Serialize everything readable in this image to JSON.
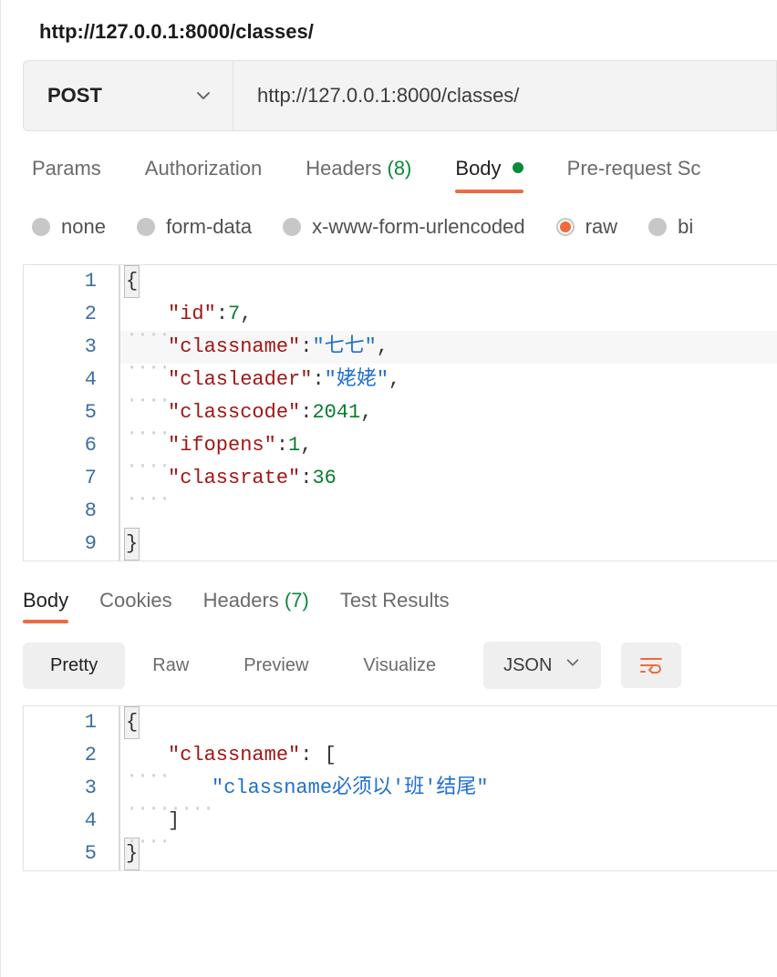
{
  "tab_title": "http://127.0.0.1:8000/classes/",
  "request": {
    "method": "POST",
    "url": "http://127.0.0.1:8000/classes/"
  },
  "request_tabs": {
    "params": "Params",
    "authorization": "Authorization",
    "headers_label": "Headers",
    "headers_count": "(8)",
    "body": "Body",
    "prerequest": "Pre-request Sc"
  },
  "body_types": {
    "none": "none",
    "form_data": "form-data",
    "xwww": "x-www-form-urlencoded",
    "raw": "raw",
    "binary": "bi"
  },
  "request_body_lines": [
    {
      "n": "1",
      "brace_open": true
    },
    {
      "n": "2",
      "indent": 4,
      "key": "\"id\"",
      "punc1": ":",
      "num": "7",
      "trail": ","
    },
    {
      "n": "3",
      "indent": 4,
      "key": "\"classname\"",
      "punc1": ":",
      "str": "\"七七\"",
      "trail": ",",
      "hl": true
    },
    {
      "n": "4",
      "indent": 4,
      "key": "\"clasleader\"",
      "punc1": ":",
      "str": "\"姥姥\"",
      "trail": ","
    },
    {
      "n": "5",
      "indent": 4,
      "key": "\"classcode\"",
      "punc1": ":",
      "num": "2041",
      "trail": ","
    },
    {
      "n": "6",
      "indent": 4,
      "key": "\"ifopens\"",
      "punc1": ":",
      "num": "1",
      "trail": ","
    },
    {
      "n": "7",
      "indent": 4,
      "key": "\"classrate\"",
      "punc1": ":",
      "num": "36"
    },
    {
      "n": "8",
      "blank": true
    },
    {
      "n": "9",
      "brace_close": true
    }
  ],
  "response_tabs": {
    "body": "Body",
    "cookies": "Cookies",
    "headers_label": "Headers",
    "headers_count": "(7)",
    "test_results": "Test Results"
  },
  "view_modes": {
    "pretty": "Pretty",
    "raw": "Raw",
    "preview": "Preview",
    "visualize": "Visualize"
  },
  "response_format": "JSON",
  "response_body_lines": [
    {
      "n": "1",
      "brace_open": true
    },
    {
      "n": "2",
      "indent": 4,
      "key": "\"classname\"",
      "punc1": ":",
      "after": " ["
    },
    {
      "n": "3",
      "indent": 8,
      "str": "\"classname必须以'班'结尾\""
    },
    {
      "n": "4",
      "indent": 4,
      "plain": "]"
    },
    {
      "n": "5",
      "brace_close": true
    }
  ]
}
